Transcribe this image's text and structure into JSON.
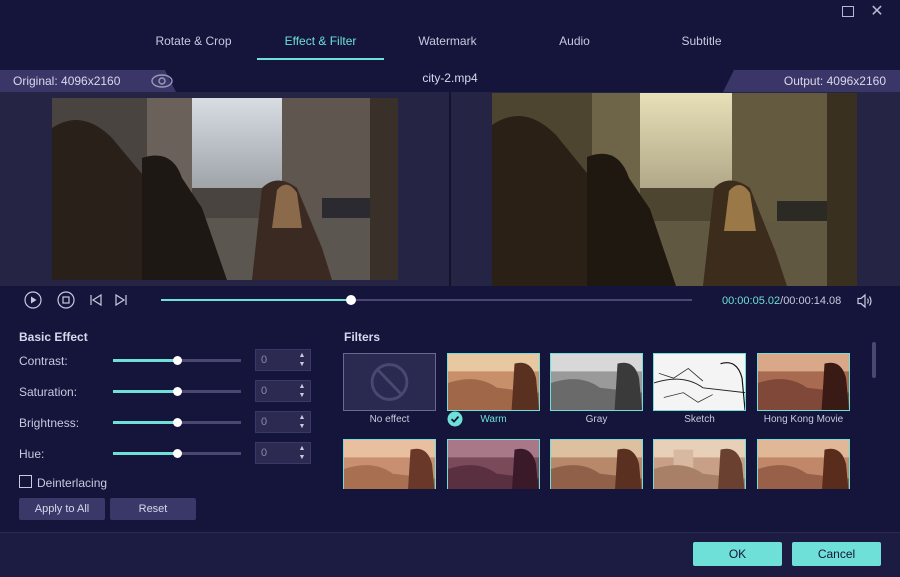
{
  "window": {
    "maximize_icon": "maximize-icon",
    "close_icon": "close-icon"
  },
  "tabs": [
    {
      "label": "Rotate & Crop"
    },
    {
      "label": "Effect & Filter"
    },
    {
      "label": "Watermark"
    },
    {
      "label": "Audio"
    },
    {
      "label": "Subtitle"
    }
  ],
  "active_tab": "Effect & Filter",
  "preview": {
    "original_label": "Original: 4096x2160",
    "filename": "city-2.mp4",
    "output_label": "Output: 4096x2160"
  },
  "playback": {
    "current_time": "00:00:05.02",
    "separator": "/",
    "total_time": "00:00:14.08",
    "progress_fraction": 0.357
  },
  "basic_effect": {
    "title": "Basic Effect",
    "rows": [
      {
        "label": "Contrast:",
        "value": "0",
        "slider_fraction": 0.5
      },
      {
        "label": "Saturation:",
        "value": "0",
        "slider_fraction": 0.5
      },
      {
        "label": "Brightness:",
        "value": "0",
        "slider_fraction": 0.5
      },
      {
        "label": "Hue:",
        "value": "0",
        "slider_fraction": 0.5
      }
    ],
    "deinterlacing_label": "Deinterlacing",
    "deinterlacing_checked": false,
    "apply_to_all": "Apply to All",
    "reset": "Reset"
  },
  "filters": {
    "title": "Filters",
    "items": [
      {
        "name": "No effect",
        "style": "none"
      },
      {
        "name": "Warm",
        "style": "warm",
        "selected": true
      },
      {
        "name": "Gray",
        "style": "gray"
      },
      {
        "name": "Sketch",
        "style": "sketch"
      },
      {
        "name": "Hong Kong Movie",
        "style": "hk"
      }
    ]
  },
  "footer": {
    "ok": "OK",
    "cancel": "Cancel"
  },
  "colors": {
    "accent": "#6ee0d8",
    "background": "#15143a",
    "panel": "#3a3868"
  }
}
